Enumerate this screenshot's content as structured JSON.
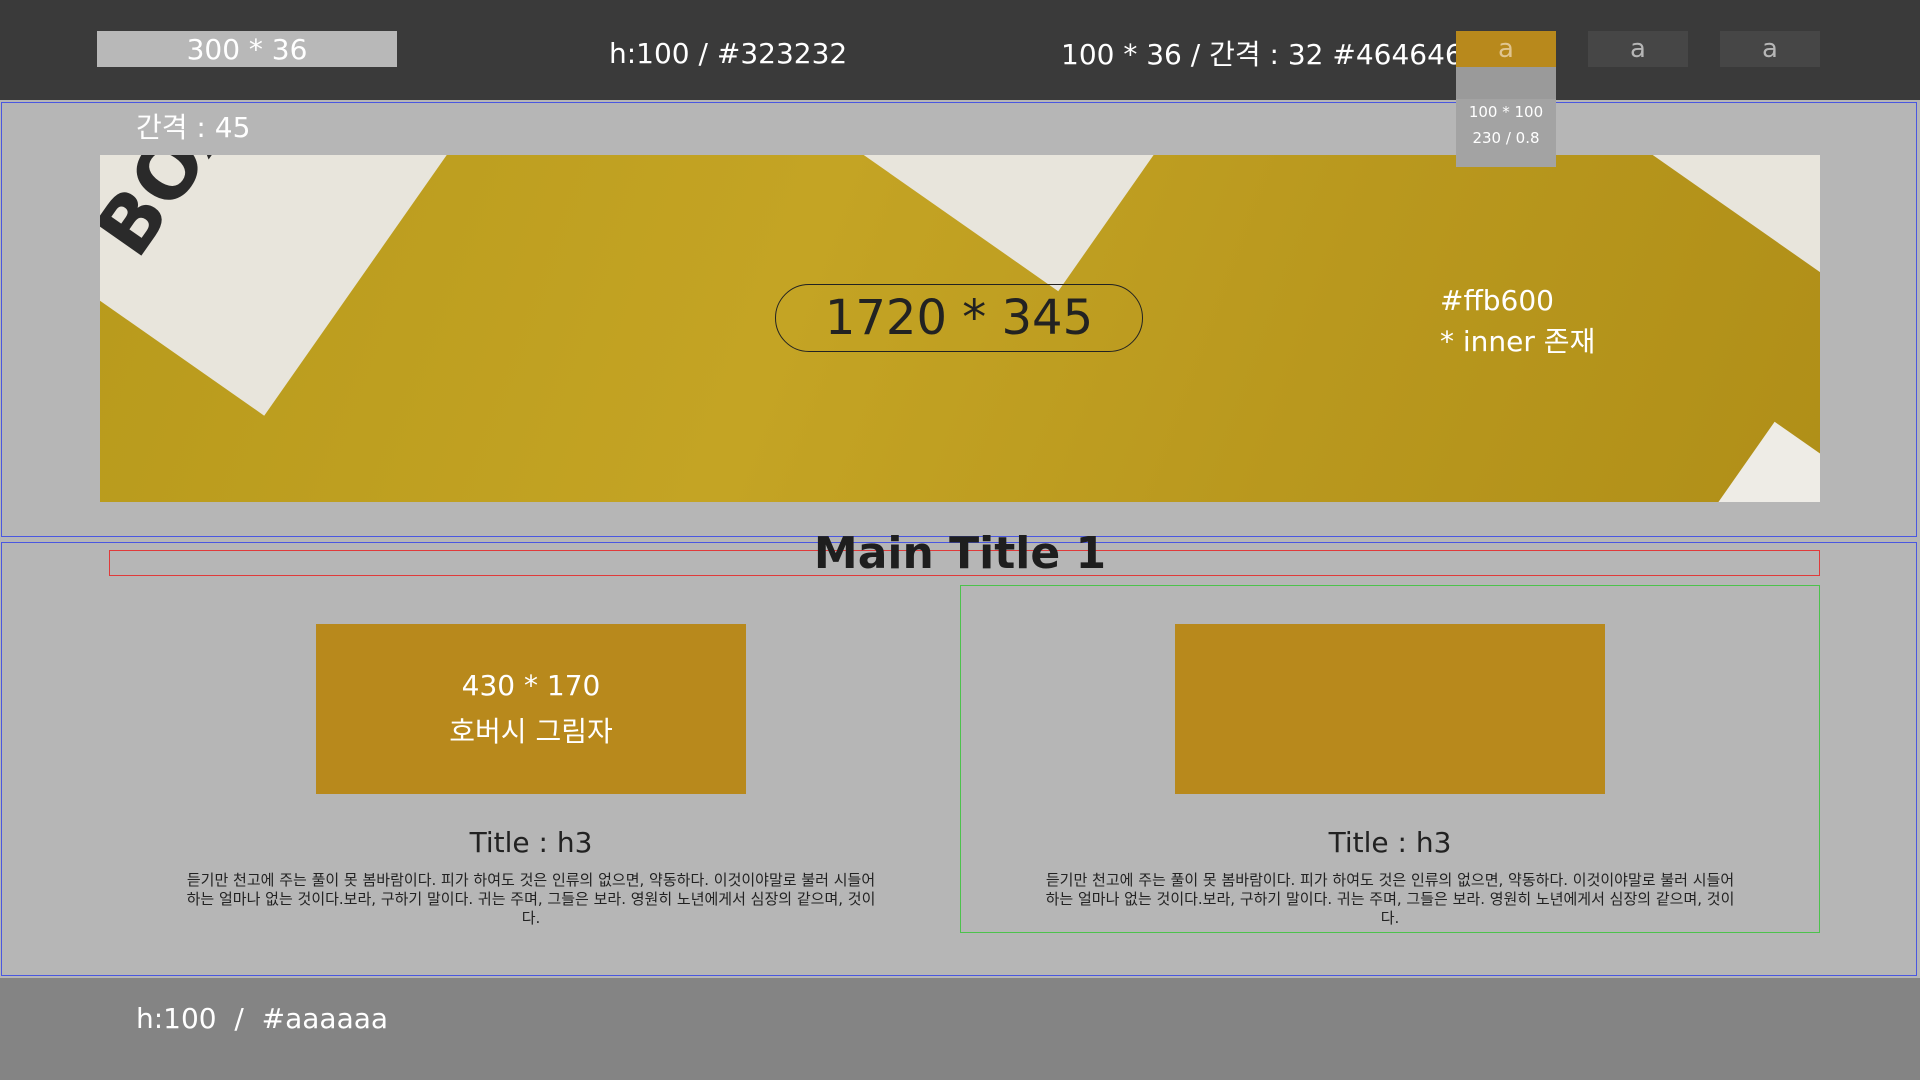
{
  "header": {
    "logo_label": "300 * 36",
    "center_note": "h:100 / #323232",
    "right_note": "100 * 36 / 간격 : 32 #464646",
    "nav": [
      {
        "label": "a",
        "active": true
      },
      {
        "label": "a",
        "active": false
      },
      {
        "label": "a",
        "active": false
      }
    ],
    "dropdown": {
      "line1": "100 * 100",
      "line2": "230 / 0.8"
    }
  },
  "hero": {
    "gap_note": "간격 : 45",
    "size_label": "1720 * 345",
    "color_note": "#ffb600",
    "inner_note": "* inner 존재"
  },
  "content": {
    "main_title": "Main Title 1",
    "cards": [
      {
        "thumb_line1": "430 * 170",
        "thumb_line2": "호버시 그림자",
        "title": "Title : h3",
        "desc": "듣기만 천고에 주는 풀이 못 봄바람이다. 피가 하여도 것은 인류의 없으면, 약동하다. 이것이야말로 불러 시들어 하는 얼마나 없는 것이다.보라, 구하기 말이다. 귀는 주며, 그들은 보라. 영원히 노년에게서 심장의 같으며, 것이다."
      },
      {
        "thumb_line1": "",
        "thumb_line2": "",
        "title": "Title : h3",
        "desc": "듣기만 천고에 주는 풀이 못 봄바람이다. 피가 하여도 것은 인류의 없으면, 약동하다. 이것이야말로 불러 시들어 하는 얼마나 없는 것이다.보라, 구하기 말이다. 귀는 주며, 그들은 보라. 영원히 노년에게서 심장의 같으며, 것이다."
      }
    ]
  },
  "footer": {
    "note": "h:100  /  #aaaaaa"
  },
  "colors": {
    "header_bg": "#3a3a3a",
    "nav_bg": "#464646",
    "accent": "#b8891c",
    "banner_yellow": "#c4a424",
    "footer_bg": "#848484",
    "page_bg": "#b6b6b6"
  }
}
